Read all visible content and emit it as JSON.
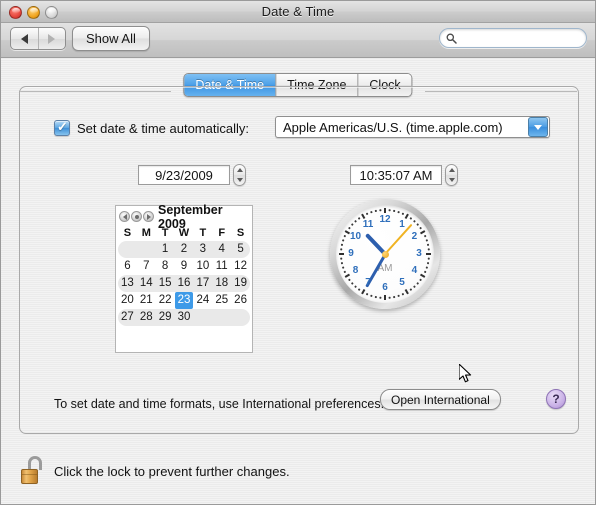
{
  "window": {
    "title": "Date & Time",
    "traffic_lights": [
      "close-button",
      "minimize-button",
      "zoom-button"
    ]
  },
  "toolbar": {
    "back_icon": "triangle-left-icon",
    "forward_icon": "triangle-right-icon",
    "show_all_label": "Show All",
    "search": {
      "placeholder": "",
      "value": "",
      "icon": "search-icon"
    }
  },
  "tabs": [
    {
      "label": "Date & Time",
      "selected": true
    },
    {
      "label": "Time Zone",
      "selected": false
    },
    {
      "label": "Clock",
      "selected": false
    }
  ],
  "main": {
    "auto_checkbox": {
      "label": "Set date & time automatically:",
      "checked": true,
      "check_glyph": "✓"
    },
    "time_server": {
      "value": "Apple Americas/U.S. (time.apple.com)",
      "arrow_icon": "chevron-down-icon"
    },
    "date_field": {
      "value": "9/23/2009",
      "stepper_icon": "stepper-up-down-icon"
    },
    "time_field": {
      "value": "10:35:07 AM",
      "stepper_icon": "stepper-up-down-icon"
    },
    "calendar": {
      "month_label": "September 2009",
      "nav_icons": [
        "prev-month-icon",
        "today-icon",
        "next-month-icon"
      ],
      "weekday_headers": [
        "S",
        "M",
        "T",
        "W",
        "T",
        "F",
        "S"
      ],
      "weeks": [
        {
          "shaded": true,
          "days": [
            "",
            "",
            "1",
            "2",
            "3",
            "4",
            "5"
          ]
        },
        {
          "shaded": false,
          "days": [
            "6",
            "7",
            "8",
            "9",
            "10",
            "11",
            "12"
          ]
        },
        {
          "shaded": true,
          "days": [
            "13",
            "14",
            "15",
            "16",
            "17",
            "18",
            "19"
          ]
        },
        {
          "shaded": false,
          "days": [
            "20",
            "21",
            "22",
            "23",
            "24",
            "25",
            "26"
          ]
        },
        {
          "shaded": true,
          "days": [
            "27",
            "28",
            "29",
            "30",
            "",
            "",
            ""
          ]
        }
      ],
      "selected_day": "23",
      "selection_color": "#3d9ae8"
    },
    "clock": {
      "numerals": [
        "12",
        "1",
        "2",
        "3",
        "4",
        "5",
        "6",
        "7",
        "8",
        "9",
        "10",
        "11"
      ],
      "ampm_label": "AM",
      "hour_angle": 316.5,
      "minute_angle": 210,
      "second_angle": 42,
      "hand_color": "#2d5fae",
      "second_hand_color": "#f0b323",
      "numeral_color": "#2f6fbb"
    },
    "format_note": "To set date and time formats, use International preferences.",
    "open_international_label": "Open International",
    "help_label": "?"
  },
  "footer": {
    "lock_icon": "unlocked-padlock-icon",
    "lock_text": "Click the lock to prevent further changes."
  },
  "cursor": {
    "icon": "arrow-cursor-icon"
  }
}
